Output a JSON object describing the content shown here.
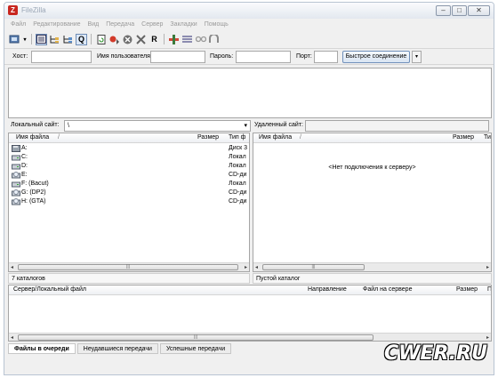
{
  "window": {
    "app_title": "FileZilla",
    "app_icon_letter": "Z"
  },
  "window_controls": {
    "minimize": "‒",
    "maximize": "□",
    "close": "✕"
  },
  "menu": [
    "Файл",
    "Редактирование",
    "Вид",
    "Передача",
    "Сервер",
    "Закладки",
    "Помощь"
  ],
  "toolbar": {
    "r_glyph": "R"
  },
  "quickconnect": {
    "host_label": "Хост:",
    "user_label": "Имя пользователя",
    "pass_label": "Пароль:",
    "port_label": "Порт:",
    "host_value": "",
    "user_value": "",
    "pass_value": "",
    "port_value": "",
    "connect_button": "Быстрое соединение",
    "dropdown_arrow": "▾"
  },
  "local": {
    "site_label": "Локальный сайт:",
    "path": "\\",
    "path_arrow": "▾",
    "col_name": "Имя файла",
    "col_size": "Размер",
    "col_type": "Тип ф",
    "sort_indicator": "/",
    "rows": [
      {
        "name": "A:",
        "type": "Диск 3",
        "icon": "floppy"
      },
      {
        "name": "C:",
        "type": "Локал",
        "icon": "hdd"
      },
      {
        "name": "D:",
        "type": "Локал",
        "icon": "hdd"
      },
      {
        "name": "E:",
        "type": "CD-ди",
        "icon": "cd"
      },
      {
        "name": "F: (Bacut)",
        "type": "Локал",
        "icon": "hdd"
      },
      {
        "name": "G: (DP2)",
        "type": "CD-ди",
        "icon": "cd"
      },
      {
        "name": "H: (GTA)",
        "type": "CD-ди",
        "icon": "cd"
      }
    ],
    "status": "7 каталогов"
  },
  "remote": {
    "site_label": "Удаленный сайт:",
    "col_name": "Имя файла",
    "col_size": "Размер",
    "col_type": "Ти",
    "sort_indicator": "/",
    "message": "<Нет подключения к серверу>",
    "status": "Пустой каталог"
  },
  "scroll": {
    "left_arrow": "◂",
    "right_arrow": "▸",
    "grip": "|||"
  },
  "queue": {
    "col_local": "Сервер/Локальный файл",
    "col_direction": "Направление",
    "col_remote": "Файл на сервере",
    "col_size": "Размер",
    "col_extra": "П"
  },
  "tabs": [
    "Файлы в очереди",
    "Неудавшиеся передачи",
    "Успешные передачи"
  ],
  "watermark": "CWER.RU"
}
